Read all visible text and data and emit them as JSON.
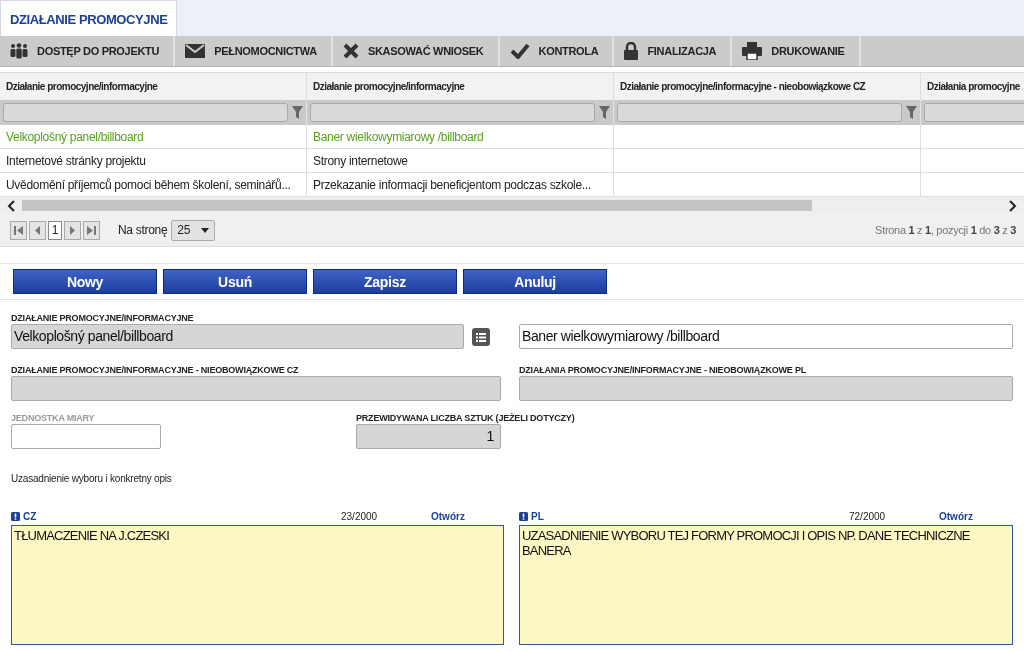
{
  "tabs": [
    {
      "label": "DZIAŁANIE PROMOCYJNE",
      "selected": true
    }
  ],
  "toolbar": [
    {
      "label": "DOSTĘP DO PROJEKTU"
    },
    {
      "label": "PEŁNOMOCNICTWA"
    },
    {
      "label": "SKASOWAĆ WNIOSEK"
    },
    {
      "label": "KONTROLA"
    },
    {
      "label": "FINALIZACJA"
    },
    {
      "label": "DRUKOWANIE"
    }
  ],
  "table": {
    "columns": [
      "Działanie promocyjne/informacyjne",
      "Działanie promocyjne/informacyjne",
      "Działanie promocyjne/informacyjne - nieobowiązkowe CZ",
      "Działania promocyjne"
    ],
    "rows": [
      {
        "selected": true,
        "cells": [
          "Velkoplošný panel/billboard",
          "Baner wielkowymiarowy /billboard"
        ]
      },
      {
        "selected": false,
        "cells": [
          "Internetové stránky projektu",
          "Strony internetowe"
        ]
      },
      {
        "selected": false,
        "cells": [
          "Uvědomění příjemců pomoci během školení, seminářů...",
          "Przekazanie informacji beneficjentom podczas szkole..."
        ]
      }
    ]
  },
  "pager": {
    "page": "1",
    "per_page_label": "Na stronę",
    "per_page": "25",
    "summary": "Strona **1** z **1**, pozycji **1** do **3** z **3**"
  },
  "buttons": [
    "Nowy",
    "Usuń",
    "Zapisz",
    "Anuluj"
  ],
  "form": {
    "main_label": "DZIAŁANIE PROMOCYJNE/INFORMACYJNE",
    "main_value": "Velkoplošný panel/billboard",
    "translation_value": "Baner wielkowymiarowy /billboard",
    "optional": [
      {
        "label": "DZIAŁANIE PROMOCYJNE/INFORMACYJNE - NIEOBOWIĄZKOWE CZ",
        "readonly": true
      },
      {
        "label": "DZIAŁANIA PROMOCYJNE/INFORMACYJNE - NIEOBOWIĄZKOWE PL",
        "readonly": true
      }
    ],
    "small": [
      {
        "label": "JEDNOSTKA MIARY",
        "dimmed": true,
        "readonly": false
      },
      {
        "label": "PRZEWIDYWANA LICZBA SZTUK (JEŻELI DOTYCZY)",
        "dimmed": false,
        "readonly": true,
        "value": "1"
      }
    ],
    "note": "Uzasadnienie wyboru i konkretny opis",
    "texts": [
      {
        "lang": "CZ",
        "counter": "23/2000",
        "link": "Otwórz",
        "value": "TŁUMACZENIE NA J.CZESKI"
      },
      {
        "lang": "PL",
        "counter": "72/2000",
        "link": "Otwórz",
        "value": "UZASADNIENIE WYBORU TEJ FORMY PROMOCJI I OPIS NP. DANE TECHNICZNE BANERA"
      }
    ]
  }
}
